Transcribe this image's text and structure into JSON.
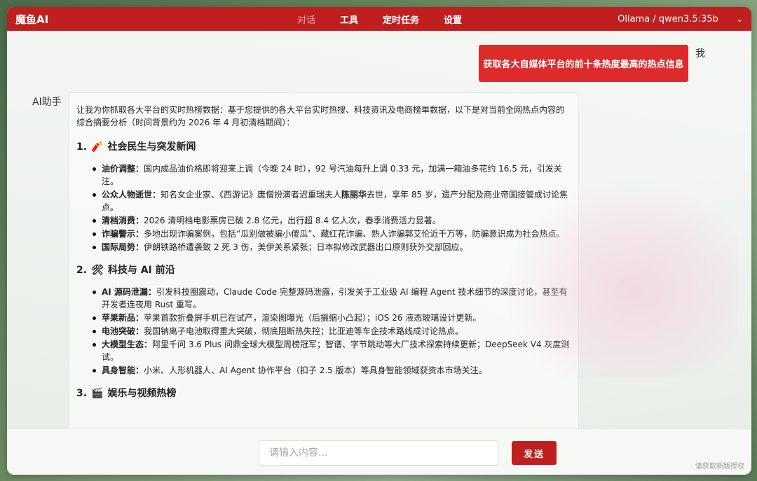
{
  "header": {
    "brand": "魔鱼AI",
    "tabs": [
      "对话",
      "工具",
      "定时任务",
      "设置"
    ],
    "active_tab": "对话",
    "model": "Ollama / qwen3.5:35b"
  },
  "messages": {
    "user_label": "我",
    "user_text": "获取各大自媒体平台的前十条热度最高的热点信息",
    "ai_label": "AI助手",
    "intro": "让我为你抓取各大平台的实时热榜数据：基于您提供的各大平台实时热搜、科技资讯及电商榜单数据，以下是对当前全网热点内容的综合摘要分析（时间背景约为 2026 年 4 月初清档期间）：",
    "sections": [
      {
        "num": "1.",
        "emoji": "🧨",
        "title": "社会民生与突发新闻",
        "items": [
          {
            "key": "油价调整：",
            "text": "国内成品油价格即将迎来上调（今晚 24 时），92 号汽油每升上调 0.33 元，加满一箱油多花约 16.5 元，引发关注。"
          },
          {
            "key": "公众人物逝世：",
            "pre": "知名女企业家、《西游记》唐僧扮演者迟重瑞夫人",
            "bold": "陈丽华",
            "post": "去世，享年 85 岁，遗产分配及商业帝国接管成讨论焦点。"
          },
          {
            "key": "清档消费：",
            "text": "2026 清明档电影票房已破 2.8 亿元，出行超 8.4 亿人次，春季消费活力显著。"
          },
          {
            "key": "诈骗警示：",
            "text": "多地出现诈骗案例，包括“瓜别做被骗小傻瓜”、藏红花诈骗、熟人诈骗郭艾伦近千万等，防骗意识成为社会热点。"
          },
          {
            "key": "国际局势：",
            "text": "伊朗铁路桥遭袭致 2 死 3 伤，美伊关系紧张；日本拟修改武器出口原则获外交部回应。"
          }
        ]
      },
      {
        "num": "2.",
        "emoji": "🛠",
        "title": "科技与 AI 前沿",
        "items": [
          {
            "key": "AI 源码泄漏：",
            "text": "引发科技圈震动，Claude Code 完整源码泄露，引发关于工业级 AI 编程 Agent 技术细节的深度讨论，甚至有开发者连夜用 Rust 重写。"
          },
          {
            "key": "苹果新品：",
            "text": "苹果首款折叠屏手机已在试产，渲染图曝光（后摄缩小凸起）；iOS 26 液态玻璃设计更新。"
          },
          {
            "key": "电池突破：",
            "text": "我国钠离子电池取得重大突破，彻底阻断热失控；比亚迪等车企技术路线成讨论热点。"
          },
          {
            "key": "大模型生态：",
            "text": "阿里千问 3.6 Plus 问鼎全球大模型周榜冠军；智谱、字节跳动等大厂技术探索持续更新；DeepSeek V4 灰度测试。"
          },
          {
            "key": "具身智能：",
            "text": "小米、人形机器人、AI Agent 协作平台（扣子 2.5 版本）等具身智能领域获资本市场关注。"
          }
        ]
      },
      {
        "num": "3.",
        "emoji": "🎬",
        "title": "娱乐与视频热榜",
        "items": []
      }
    ]
  },
  "input": {
    "placeholder": "请输入内容...",
    "send_label": "发送",
    "license_link": "请获取新版授权"
  }
}
